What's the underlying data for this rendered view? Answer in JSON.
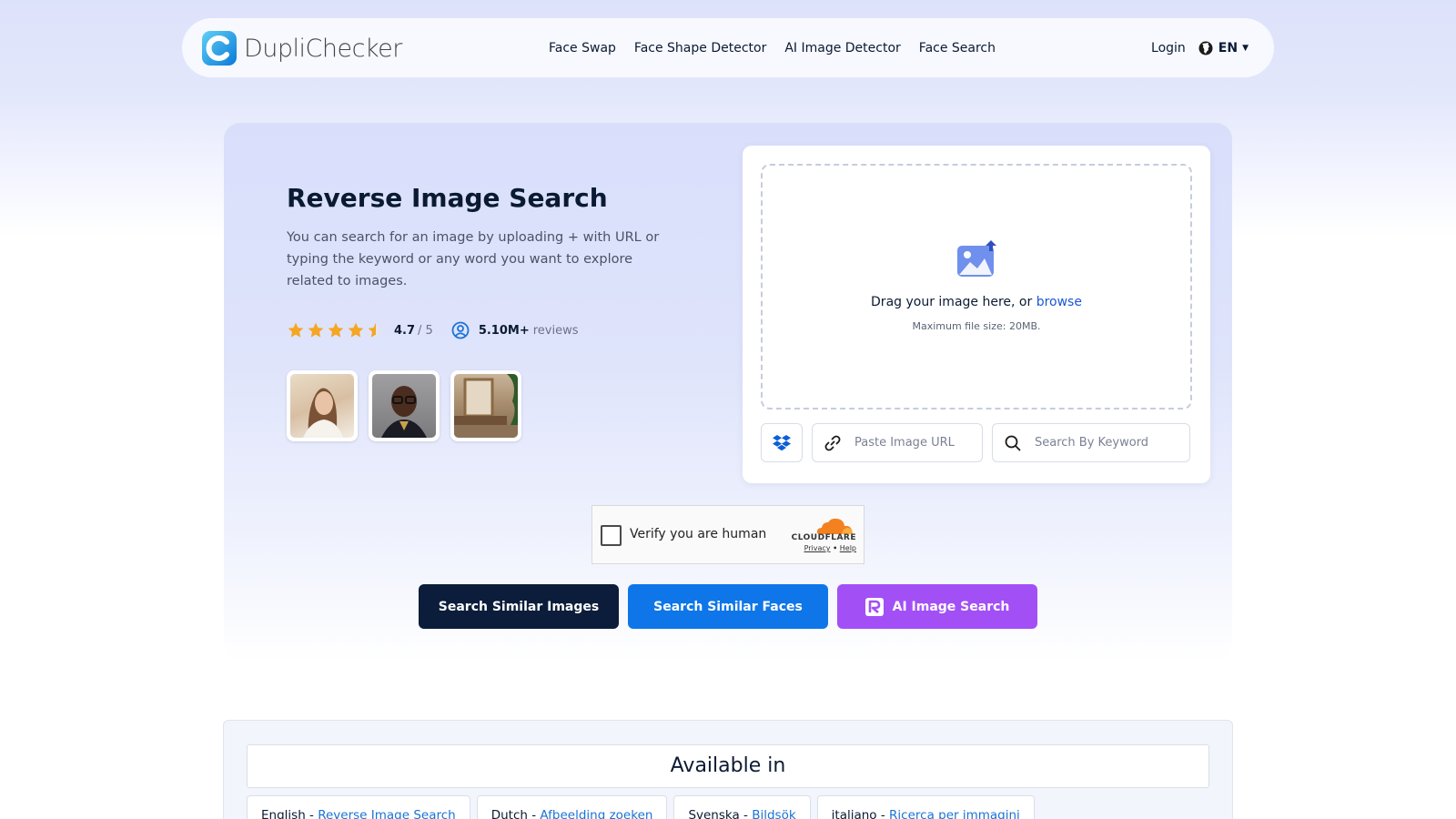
{
  "brand": {
    "name": "DupliChecker"
  },
  "nav": {
    "items": [
      {
        "label": "Face Swap"
      },
      {
        "label": "Face Shape Detector"
      },
      {
        "label": "AI Image Detector"
      },
      {
        "label": "Face Search"
      }
    ],
    "login": "Login",
    "language": "EN"
  },
  "hero": {
    "title": "Reverse Image Search",
    "description": "You can search for an image by uploading + with URL or typing the keyword or any word you want to explore related to images.",
    "rating": {
      "score": "4.7",
      "out_of": "/ 5",
      "stars": 4.5,
      "reviews_count": "5.10M+",
      "reviews_label": "reviews"
    }
  },
  "upload": {
    "drag_text": "Drag your image here, or",
    "browse": "browse",
    "max_size": "Maximum file size: 20MB.",
    "url_placeholder": "Paste Image URL",
    "keyword_placeholder": "Search By Keyword"
  },
  "captcha": {
    "label": "Verify you are human",
    "provider": "CLOUDFLARE",
    "privacy": "Privacy",
    "separator": "•",
    "help": "Help"
  },
  "actions": {
    "similar_images": "Search Similar Images",
    "similar_faces": "Search Similar Faces",
    "ai_search": "AI Image Search"
  },
  "available": {
    "title": "Available in",
    "languages": [
      {
        "name": "English - ",
        "link": "Reverse Image Search"
      },
      {
        "name": "Dutch - ",
        "link": "Afbeelding zoeken"
      },
      {
        "name": "Svenska - ",
        "link": "Bildsök"
      },
      {
        "name": "italiano - ",
        "link": "Ricerca per immagini"
      }
    ]
  },
  "colors": {
    "primary_dark": "#0b1d3a",
    "primary_blue": "#0e76e8",
    "accent_purple": "#a34ff6",
    "link_blue": "#1a56d6",
    "star": "#f5a623"
  }
}
